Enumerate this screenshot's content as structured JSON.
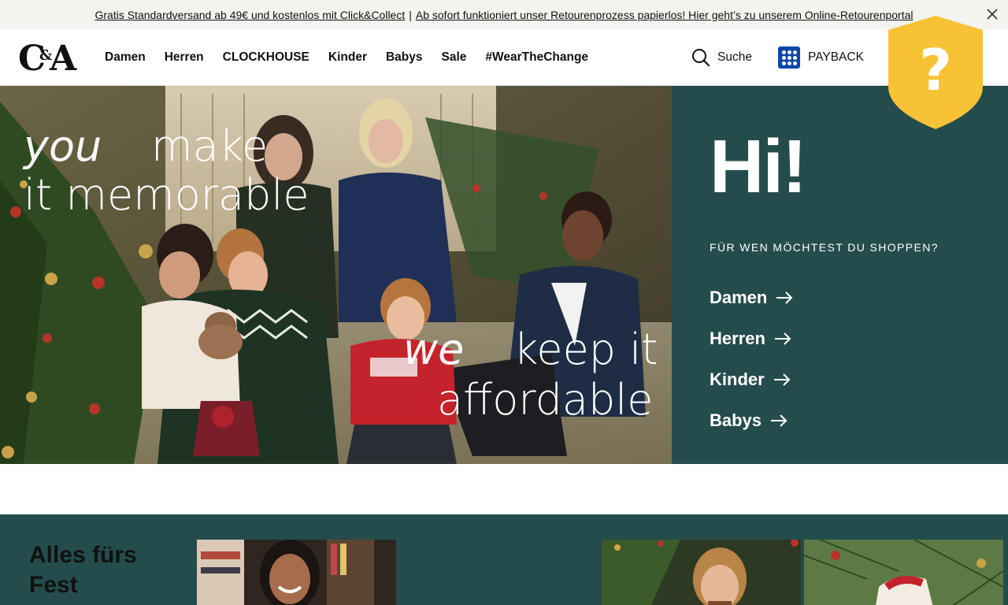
{
  "topbar": {
    "link1": "Gratis Standardversand ab 49€ und kostenlos mit Click&Collect",
    "separator": "|",
    "link2": "Ab sofort funktioniert unser Retourenprozess papierlos! Hier geht’s zu unserem Online-Retourenportal"
  },
  "header": {
    "logo_text": "C&A",
    "nav": [
      {
        "label": "Damen"
      },
      {
        "label": "Herren"
      },
      {
        "label": "CLOCKHOUSE"
      },
      {
        "label": "Kinder"
      },
      {
        "label": "Babys"
      },
      {
        "label": "Sale"
      },
      {
        "label": "#WearTheChange"
      }
    ],
    "search_label": "Suche",
    "payback_label": "PAYBACK"
  },
  "shield": {
    "symbol": "?"
  },
  "hero": {
    "line1_a": "you",
    "line1_b": "make",
    "line2": "it memorable",
    "line3_a": "we",
    "line3_b": "keep it",
    "line4": "affordable"
  },
  "panel": {
    "greeting": "Hi!",
    "question": "FÜR WEN MÖCHTEST DU SHOPPEN?",
    "links": [
      {
        "label": "Damen"
      },
      {
        "label": "Herren"
      },
      {
        "label": "Kinder"
      },
      {
        "label": "Babys"
      }
    ]
  },
  "section": {
    "title": "Alles fürs Fest"
  },
  "colors": {
    "teal": "#254c4c",
    "shield_yellow": "#f8c236",
    "payback_blue": "#0b47a8",
    "topbar_bg": "#f3f3ef"
  }
}
